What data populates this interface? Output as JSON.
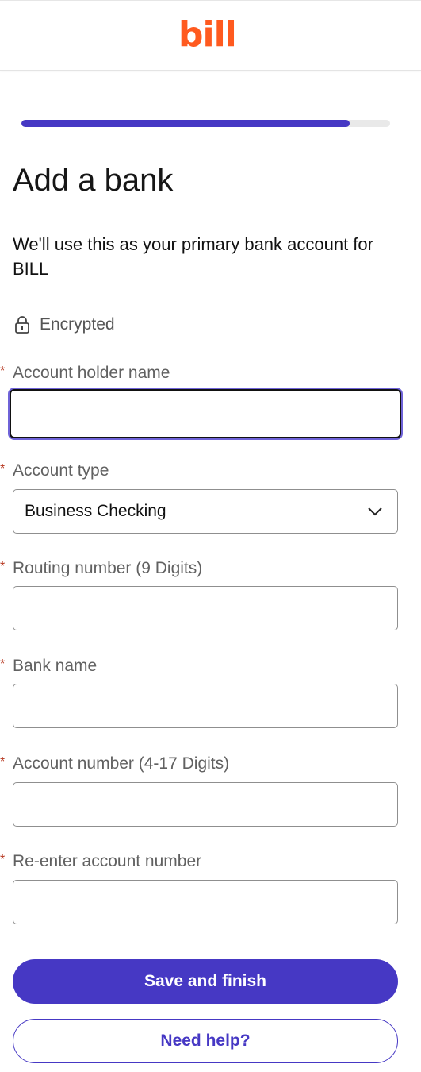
{
  "header": {
    "logo_text": "bill",
    "brand_color": "#ff5a1f"
  },
  "progress": {
    "fraction": 0.89,
    "accent": "#4638c4"
  },
  "page": {
    "title": "Add a bank",
    "subtitle": "We'll use this as your primary bank account for BILL",
    "encrypted_label": "Encrypted"
  },
  "form": {
    "required_marker": "*",
    "account_holder": {
      "label": "Account holder name",
      "value": ""
    },
    "account_type": {
      "label": "Account type",
      "value": "Business Checking"
    },
    "routing": {
      "label": "Routing number (9 Digits)",
      "value": ""
    },
    "bank_name": {
      "label": "Bank name",
      "value": ""
    },
    "account_number": {
      "label": "Account number (4-17 Digits)",
      "value": ""
    },
    "reenter": {
      "label": "Re-enter account number",
      "value": ""
    }
  },
  "actions": {
    "save_label": "Save and finish",
    "help_label": "Need help?"
  }
}
